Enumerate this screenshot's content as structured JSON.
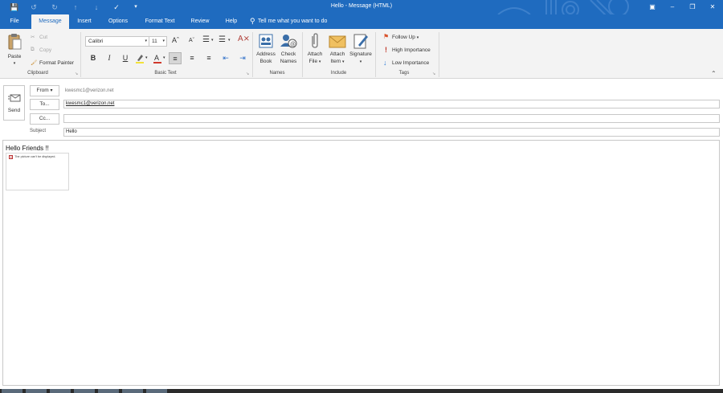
{
  "window": {
    "title": "Hello  -  Message (HTML)",
    "controls": [
      "restore-ribbon-icon",
      "minimize-icon",
      "maximize-icon",
      "close-icon"
    ]
  },
  "tabs": [
    {
      "label": "File"
    },
    {
      "label": "Message"
    },
    {
      "label": "Insert"
    },
    {
      "label": "Options"
    },
    {
      "label": "Format Text"
    },
    {
      "label": "Review"
    },
    {
      "label": "Help"
    }
  ],
  "active_tab": "Message",
  "tell_me": "Tell me what you want to do",
  "ribbon": {
    "clipboard": {
      "paste": "Paste",
      "cut": "Cut",
      "copy": "Copy",
      "format_painter": "Format Painter",
      "label": "Clipboard"
    },
    "basic_text": {
      "font": "Calibri",
      "size": "11",
      "bold": "B",
      "italic": "I",
      "underline": "U",
      "label": "Basic Text"
    },
    "names": {
      "address_book_1": "Address",
      "address_book_2": "Book",
      "check_names_1": "Check",
      "check_names_2": "Names",
      "label": "Names"
    },
    "include": {
      "attach_file_1": "Attach",
      "attach_file_2": "File",
      "attach_item_1": "Attach",
      "attach_item_2": "Item",
      "signature": "Signature",
      "label": "Include"
    },
    "tags": {
      "follow_up": "Follow Up",
      "high_importance": "High Importance",
      "low_importance": "Low Importance",
      "label": "Tags"
    }
  },
  "header": {
    "send": "Send",
    "from_label": "From",
    "from_value": "kwesmc1@verizon.net",
    "to_label": "To...",
    "to_value": "kwesmc1@verizon.net",
    "cc_label": "Cc...",
    "cc_value": "",
    "subject_label": "Subject",
    "subject_value": "Hello"
  },
  "body": {
    "greeting": "Hello Friends !!",
    "image_placeholder": "The picture can't be displayed."
  },
  "colors": {
    "accent": "#1f6bbf",
    "ribbon_bg": "#f3f3f3",
    "follow_up_flag": "#d9532c",
    "high_importance": "#c0392b",
    "low_importance": "#2e7bd6"
  }
}
